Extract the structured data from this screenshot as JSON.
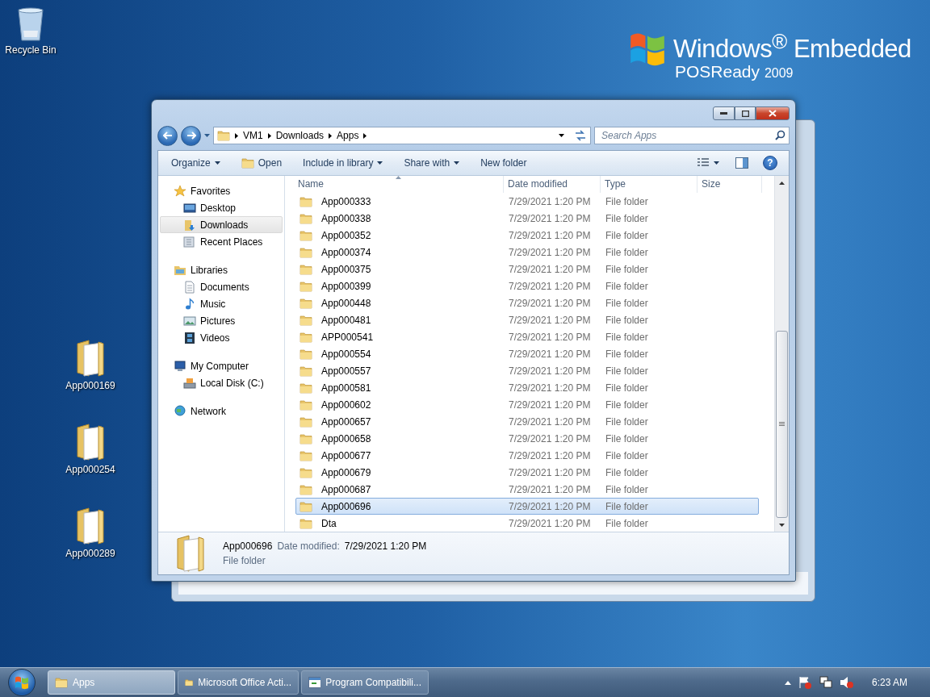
{
  "desktop": {
    "icons": [
      {
        "label": "Recycle Bin",
        "kind": "bin"
      },
      {
        "label": "App000169",
        "kind": "folder"
      },
      {
        "label": "App000254",
        "kind": "folder"
      },
      {
        "label": "App000289",
        "kind": "folder"
      }
    ],
    "logo": {
      "title": "Windows$^{®}$ Embedded",
      "subtitle": "POSReady",
      "version": "2009"
    }
  },
  "window": {
    "breadcrumb": [
      "VM1",
      "Downloads",
      "Apps"
    ],
    "search": {
      "placeholder": "Search Apps"
    },
    "toolbar": [
      {
        "label": "Open",
        "kind": "open"
      },
      {
        "label": "Include in library",
        "kind": "menu"
      },
      {
        "label": "Share with",
        "kind": "menu"
      },
      {
        "label": "New folder",
        "kind": "plain"
      }
    ],
    "organize": "Organize",
    "help": "?",
    "navigation": [
      {
        "label": "Favorites",
        "kind": "star",
        "selected": false,
        "children": [
          {
            "label": "Desktop",
            "kind": "desktop",
            "selected": false
          },
          {
            "label": "Downloads",
            "kind": "download",
            "selected": true
          },
          {
            "label": "Recent Places",
            "kind": "recent",
            "selected": false
          }
        ]
      },
      {
        "label": "Libraries",
        "kind": "library",
        "selected": false,
        "children": [
          {
            "label": "Documents",
            "kind": "document",
            "selected": false
          },
          {
            "label": "Music",
            "kind": "music",
            "selected": false
          },
          {
            "label": "Pictures",
            "kind": "picture",
            "selected": false
          },
          {
            "label": "Videos",
            "kind": "video",
            "selected": false
          }
        ]
      },
      {
        "label": "My Computer",
        "kind": "computer",
        "selected": false,
        "children": [
          {
            "label": "Local Disk (C:)",
            "kind": "disk",
            "selected": false
          }
        ]
      },
      {
        "label": "Network",
        "kind": "network",
        "selected": false
      }
    ],
    "columns": [
      "Name",
      "Date modified",
      "Type",
      "Size"
    ],
    "rows": [
      {
        "name": "App000333",
        "date": "7/29/2021 1:20 PM",
        "type": "File folder",
        "selected": false
      },
      {
        "name": "App000338",
        "date": "7/29/2021 1:20 PM",
        "type": "File folder",
        "selected": false
      },
      {
        "name": "App000352",
        "date": "7/29/2021 1:20 PM",
        "type": "File folder",
        "selected": false
      },
      {
        "name": "App000374",
        "date": "7/29/2021 1:20 PM",
        "type": "File folder",
        "selected": false
      },
      {
        "name": "App000375",
        "date": "7/29/2021 1:20 PM",
        "type": "File folder",
        "selected": false
      },
      {
        "name": "App000399",
        "date": "7/29/2021 1:20 PM",
        "type": "File folder",
        "selected": false
      },
      {
        "name": "App000448",
        "date": "7/29/2021 1:20 PM",
        "type": "File folder",
        "selected": false
      },
      {
        "name": "App000481",
        "date": "7/29/2021 1:20 PM",
        "type": "File folder",
        "selected": false
      },
      {
        "name": "APP000541",
        "date": "7/29/2021 1:20 PM",
        "type": "File folder",
        "selected": false
      },
      {
        "name": "App000554",
        "date": "7/29/2021 1:20 PM",
        "type": "File folder",
        "selected": false
      },
      {
        "name": "App000557",
        "date": "7/29/2021 1:20 PM",
        "type": "File folder",
        "selected": false
      },
      {
        "name": "App000581",
        "date": "7/29/2021 1:20 PM",
        "type": "File folder",
        "selected": false
      },
      {
        "name": "App000602",
        "date": "7/29/2021 1:20 PM",
        "type": "File folder",
        "selected": false
      },
      {
        "name": "App000657",
        "date": "7/29/2021 1:20 PM",
        "type": "File folder",
        "selected": false
      },
      {
        "name": "App000658",
        "date": "7/29/2021 1:20 PM",
        "type": "File folder",
        "selected": false
      },
      {
        "name": "App000677",
        "date": "7/29/2021 1:20 PM",
        "type": "File folder",
        "selected": false
      },
      {
        "name": "App000679",
        "date": "7/29/2021 1:20 PM",
        "type": "File folder",
        "selected": false
      },
      {
        "name": "App000687",
        "date": "7/29/2021 1:20 PM",
        "type": "File folder",
        "selected": false
      },
      {
        "name": "App000696",
        "date": "7/29/2021 1:20 PM",
        "type": "File folder",
        "selected": true
      },
      {
        "name": "Dta",
        "date": "7/29/2021 1:20 PM",
        "type": "File folder",
        "selected": false
      }
    ],
    "details": {
      "name": "App000696",
      "date_label": "Date modified:",
      "date": "7/29/2021 1:20 PM",
      "type": "File folder"
    }
  },
  "taskbar": {
    "tasks": [
      {
        "label": "Apps",
        "kind": "folder",
        "selected": true
      },
      {
        "label": "Microsoft Office Acti...",
        "kind": "folder",
        "selected": false
      },
      {
        "label": "Program Compatibili...",
        "kind": "program",
        "selected": false
      }
    ],
    "clock": "6:23 AM"
  }
}
